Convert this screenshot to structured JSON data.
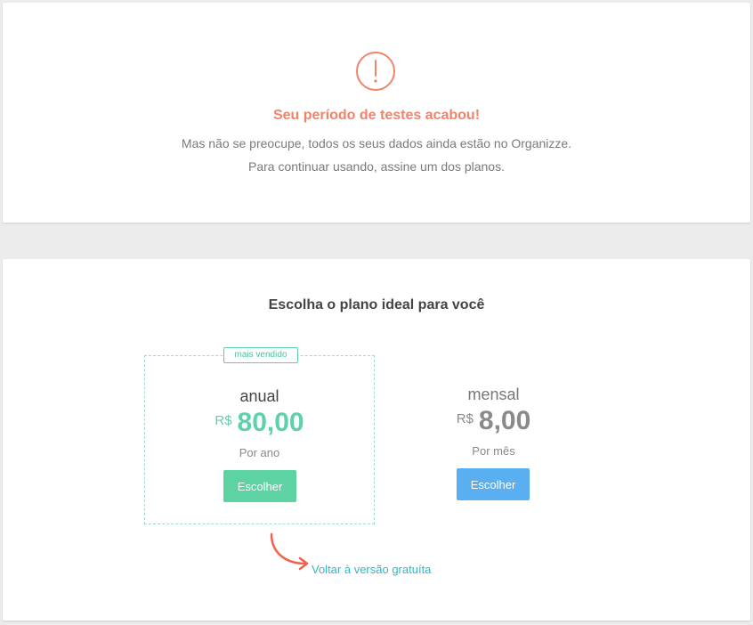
{
  "alert": {
    "icon": "exclamation-circle-icon",
    "title": "Seu período de testes acabou!",
    "line1": "Mas não se preocupe, todos os seus dados ainda estão no Organizze.",
    "line2": "Para continuar usando, assine um dos planos."
  },
  "plans": {
    "title": "Escolha o plano ideal para você",
    "items": [
      {
        "badge": "mais vendido",
        "name": "anual",
        "currency": "R$",
        "price": "80,00",
        "period": "Por ano",
        "button": "Escolher"
      },
      {
        "name": "mensal",
        "currency": "R$",
        "price": "8,00",
        "period": "Por mês",
        "button": "Escolher"
      }
    ]
  },
  "back_link": "Voltar à versão gratuíta",
  "colors": {
    "alert": "#f2836b",
    "annual_accent": "#5dd3a4",
    "monthly_button": "#5aaff0",
    "link": "#2fb7c4",
    "arrow": "#f0624d"
  }
}
